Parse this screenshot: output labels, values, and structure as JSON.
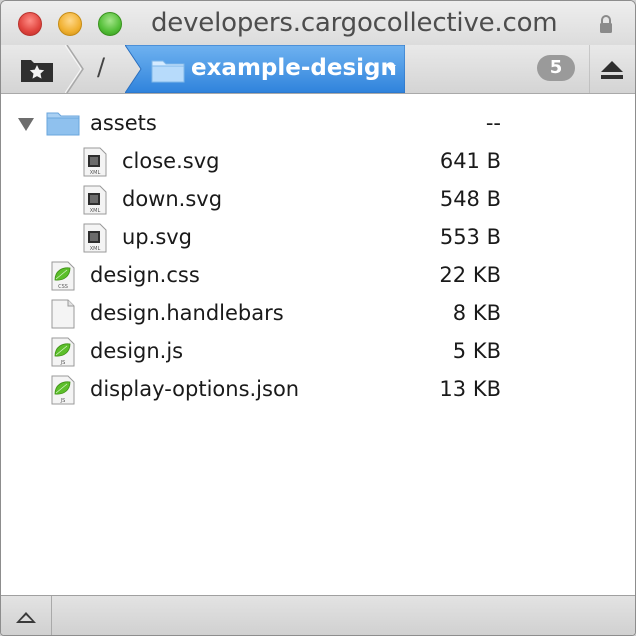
{
  "window": {
    "title": "developers.cargocollective.com"
  },
  "toolbar": {
    "root_crumb": "/",
    "current_folder": "example-design",
    "badge_count": "5"
  },
  "files": [
    {
      "name": "assets",
      "size": "--",
      "kind": "folder",
      "level": 0,
      "expanded": true
    },
    {
      "name": "close.svg",
      "size": "641 B",
      "kind": "svg",
      "icon_label": "XML",
      "level": 1
    },
    {
      "name": "down.svg",
      "size": "548 B",
      "kind": "svg",
      "icon_label": "XML",
      "level": 1
    },
    {
      "name": "up.svg",
      "size": "553 B",
      "kind": "svg",
      "icon_label": "XML",
      "level": 1
    },
    {
      "name": "design.css",
      "size": "22 KB",
      "kind": "leaf",
      "icon_label": "CSS",
      "level": 0
    },
    {
      "name": "design.handlebars",
      "size": "8 KB",
      "kind": "blank",
      "level": 0
    },
    {
      "name": "design.js",
      "size": "5 KB",
      "kind": "leaf",
      "icon_label": "JS",
      "level": 0
    },
    {
      "name": "display-options.json",
      "size": "13 KB",
      "kind": "leaf",
      "icon_label": "JS",
      "level": 0
    }
  ],
  "colors": {
    "accent": "#3c8fdd",
    "folder": "#8fc1ee",
    "leaf_green": "#5cbf2a"
  }
}
